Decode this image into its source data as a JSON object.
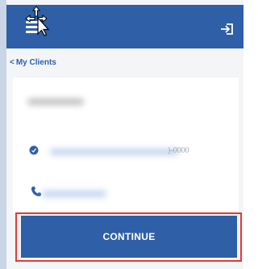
{
  "header": {
    "menu_icon": "hamburger-icon",
    "logout_icon": "sign-out-icon",
    "cursor_icon": "move-cursor-icon"
  },
  "nav": {
    "back_chevron": "<",
    "back_label": "My Clients"
  },
  "client": {
    "name": "",
    "phone_mask_suffix": ")-0000",
    "email_icon": "location-pin-icon",
    "phone_icon": "phone-icon"
  },
  "actions": {
    "continue_label": "CONTINUE"
  },
  "colors": {
    "brand": "#2f5fa7",
    "highlight": "#e53935",
    "page_bg": "#f4f5f7"
  }
}
